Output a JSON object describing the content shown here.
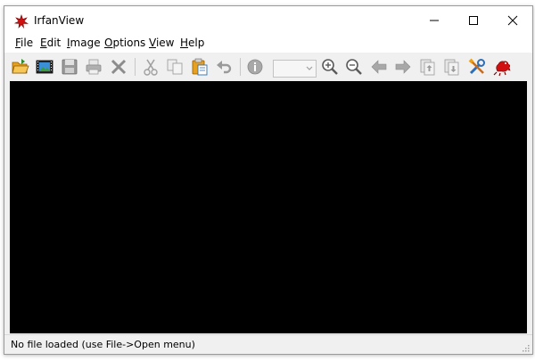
{
  "window": {
    "title": "IrfanView"
  },
  "menu": [
    {
      "label": "File"
    },
    {
      "label": "Edit"
    },
    {
      "label": "Image"
    },
    {
      "label": "Options"
    },
    {
      "label": "View"
    },
    {
      "label": "Help"
    }
  ],
  "toolbar": {
    "buttons": [
      {
        "icon": "open-folder-icon",
        "enabled": true
      },
      {
        "icon": "slideshow-icon",
        "enabled": true
      },
      {
        "icon": "save-icon",
        "enabled": false
      },
      {
        "icon": "print-icon",
        "enabled": false
      },
      {
        "icon": "delete-icon",
        "enabled": false
      },
      {
        "icon": "cut-icon",
        "enabled": false
      },
      {
        "icon": "copy-icon",
        "enabled": false
      },
      {
        "icon": "paste-icon",
        "enabled": true
      },
      {
        "icon": "undo-icon",
        "enabled": false
      },
      {
        "icon": "info-icon",
        "enabled": false
      },
      {
        "icon": "zoom-in-icon",
        "enabled": true
      },
      {
        "icon": "zoom-out-icon",
        "enabled": true
      },
      {
        "icon": "previous-icon",
        "enabled": false
      },
      {
        "icon": "next-icon",
        "enabled": false
      },
      {
        "icon": "first-page-icon",
        "enabled": false
      },
      {
        "icon": "last-page-icon",
        "enabled": false
      },
      {
        "icon": "properties-icon",
        "enabled": true
      },
      {
        "icon": "irfanview-logo-icon",
        "enabled": true
      }
    ],
    "zoom_value": ""
  },
  "status": {
    "text": "No file loaded (use File->Open menu)"
  },
  "colors": {
    "canvas": "#000000",
    "chrome": "#f0f0f0",
    "accent_red": "#d01010",
    "icon_blue": "#2d6fb7",
    "icon_orange": "#e8a020"
  }
}
